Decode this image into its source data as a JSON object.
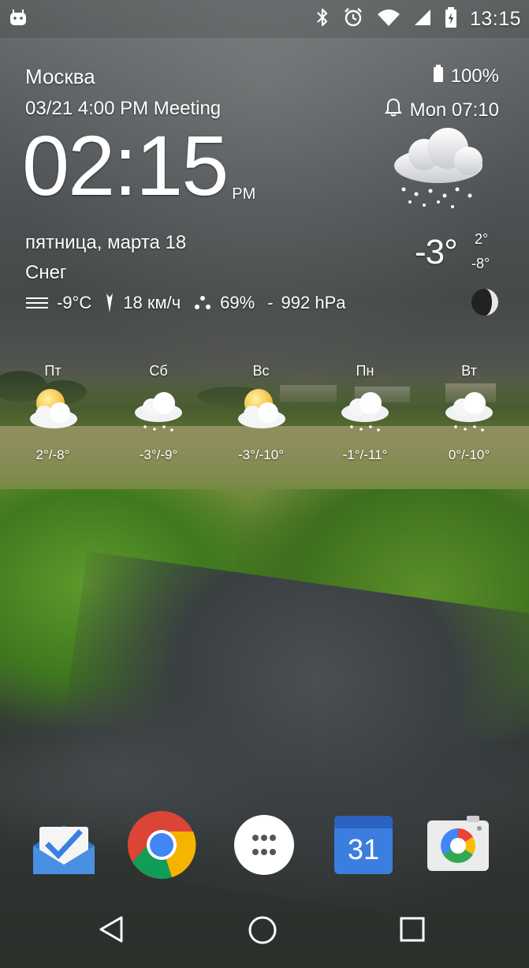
{
  "status_bar": {
    "time": "13:15",
    "icons": [
      "android-notification-icon",
      "bluetooth-icon",
      "alarm-clock-icon",
      "wifi-icon",
      "cell-signal-icon",
      "battery-charging-icon"
    ]
  },
  "widget": {
    "city": "Москва",
    "battery": "100%",
    "event": "03/21 4:00 PM Meeting",
    "alarm": "Mon 07:10",
    "time": "02:15",
    "ampm": "PM",
    "date": "пятница, марта 18",
    "condition": "Снег",
    "feels_like": "-9°C",
    "wind": "18 км/ч",
    "humidity": "69%",
    "pressure_separator": "-",
    "pressure": "992 hPa",
    "temp_now": "-3°",
    "temp_high": "2°",
    "temp_low": "-8°",
    "icons": [
      "wind-icon",
      "wind-direction-icon",
      "humidity-icon",
      "snow-cloud-icon",
      "moon-phase-icon",
      "battery-icon",
      "bell-icon"
    ]
  },
  "forecast": [
    {
      "day": "Пт",
      "temp": "2°/-8°",
      "icon": "sun-cloud-icon"
    },
    {
      "day": "Сб",
      "temp": "-3°/-9°",
      "icon": "snow-cloud-icon"
    },
    {
      "day": "Вс",
      "temp": "-3°/-10°",
      "icon": "sun-cloud-icon"
    },
    {
      "day": "Пн",
      "temp": "-1°/-11°",
      "icon": "snow-cloud-icon"
    },
    {
      "day": "Вт",
      "temp": "0°/-10°",
      "icon": "snow-cloud-icon"
    }
  ],
  "dock": {
    "apps": [
      "inbox-app-icon",
      "chrome-app-icon",
      "app-drawer-icon",
      "calendar-app-icon",
      "camera-app-icon"
    ],
    "calendar_day": "31"
  },
  "nav": {
    "buttons": [
      "back-icon",
      "home-icon",
      "recents-icon"
    ]
  },
  "colors": {
    "text": "#ffffff",
    "sky": "#5d6062",
    "grass": "#4f7a25",
    "chrome_red": "#db4437",
    "chrome_yellow": "#f4b400",
    "chrome_green": "#0f9d58",
    "chrome_blue": "#4285f4",
    "calendar_blue": "#3b7ee0"
  }
}
